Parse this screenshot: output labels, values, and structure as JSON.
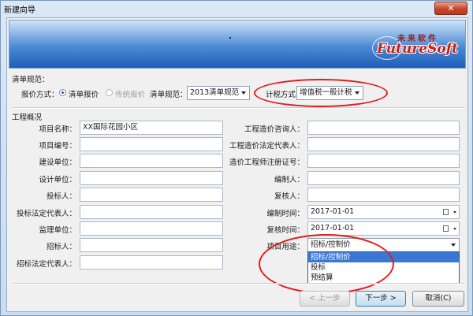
{
  "window": {
    "title": "新建向导",
    "close": "✕"
  },
  "banner": {
    "logo_cn": "未来软件",
    "logo_en": "FutureSoft"
  },
  "qingdan": {
    "section": "清单规范：",
    "pricing_label": "报价方式：",
    "radio1": "清单报价",
    "radio2": "传统报价",
    "spec_label": "清单规范：",
    "spec_value": "2013清单规范",
    "tax_label": "计税方式：",
    "tax_value": "增值税一般计税"
  },
  "project": {
    "section": "工程概况",
    "left": [
      {
        "label": "项目名称：",
        "value": "XX国际花园小区"
      },
      {
        "label": "项目编号：",
        "value": ""
      },
      {
        "label": "建设单位：",
        "value": ""
      },
      {
        "label": "设计单位：",
        "value": ""
      },
      {
        "label": "投标人：",
        "value": ""
      },
      {
        "label": "投标法定代表人：",
        "value": ""
      },
      {
        "label": "监理单位：",
        "value": ""
      },
      {
        "label": "招标人：",
        "value": ""
      },
      {
        "label": "招标法定代表人：",
        "value": ""
      }
    ],
    "right": [
      {
        "label": "工程造价咨询人：",
        "value": ""
      },
      {
        "label": "工程造价法定代表人：",
        "value": ""
      },
      {
        "label": "造价工程师注册证号：",
        "value": ""
      },
      {
        "label": "编制人：",
        "value": ""
      },
      {
        "label": "复核人：",
        "value": ""
      },
      {
        "label": "编制时间：",
        "value": "2017-01-01"
      },
      {
        "label": "复核时间：",
        "value": "2017-01-01"
      }
    ],
    "purpose_label": "项目用途：",
    "purpose_value": "招标/控制价",
    "purpose_options": [
      "招标/控制价",
      "投标",
      "预结算"
    ]
  },
  "footer": {
    "prev": "< 上一步",
    "next": "下一步 >",
    "cancel": "取消(C)"
  },
  "colors": {
    "accent": "#1d5fb8",
    "highlight_ellipse": "#e21b1b",
    "selected_item": "#3a78d6"
  }
}
